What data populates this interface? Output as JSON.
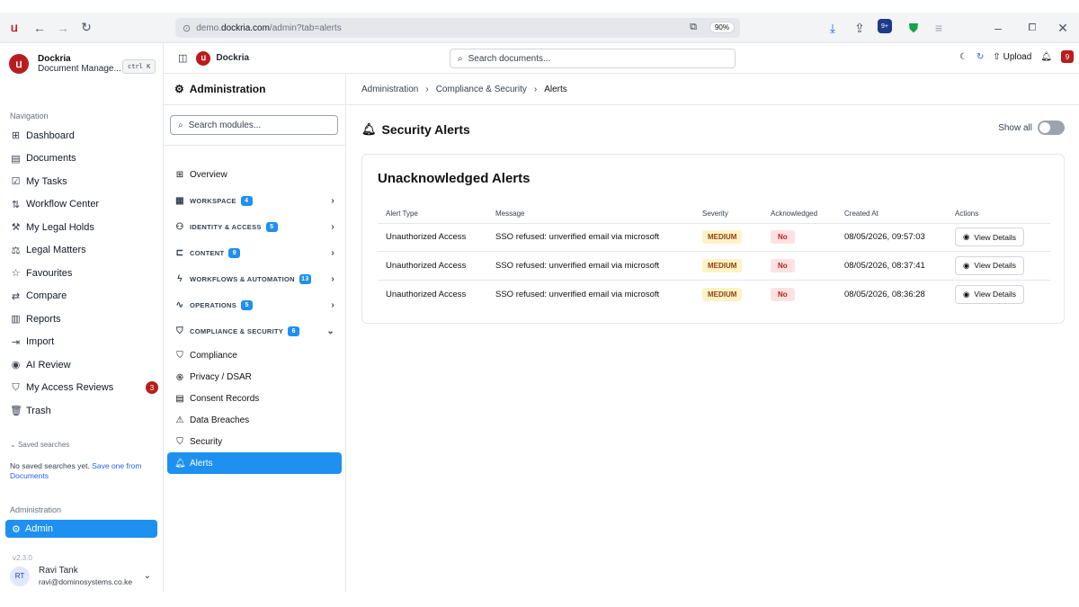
{
  "browser": {
    "url_prefix": "demo.",
    "url_domain": "dockria.com",
    "url_path": "/admin?tab=alerts",
    "zoom": "90%",
    "extension_badge": "9+"
  },
  "app": {
    "name": "Dockria",
    "subtitle": "Document Manage...",
    "shortcut": "ctrl K",
    "version": "v2.3.0"
  },
  "nav": {
    "label": "Navigation",
    "items": [
      {
        "label": "Dashboard",
        "icon": "grid-icon"
      },
      {
        "label": "Documents",
        "icon": "document-icon"
      },
      {
        "label": "My Tasks",
        "icon": "checkbox-icon"
      },
      {
        "label": "Workflow Center",
        "icon": "workflow-icon"
      },
      {
        "label": "My Legal Holds",
        "icon": "gavel-icon"
      },
      {
        "label": "Legal Matters",
        "icon": "scales-icon"
      },
      {
        "label": "Favourites",
        "icon": "star-icon"
      },
      {
        "label": "Compare",
        "icon": "compare-icon"
      },
      {
        "label": "Reports",
        "icon": "chart-icon"
      },
      {
        "label": "Import",
        "icon": "import-icon"
      },
      {
        "label": "AI Review",
        "icon": "ai-icon"
      },
      {
        "label": "My Access Reviews",
        "icon": "shield-check-icon",
        "badge": "3"
      },
      {
        "label": "Trash",
        "icon": "trash-icon"
      }
    ],
    "saved_label": "Saved searches",
    "no_saved": "No saved searches yet.",
    "save_link": "Save one from Documents",
    "admin_label": "Administration",
    "admin_button": "Admin"
  },
  "user": {
    "initials": "RT",
    "name": "Ravi Tank",
    "email": "ravi@dominosystems.co.ke"
  },
  "topbar": {
    "brand": "Dockria",
    "search_placeholder": "Search documents...",
    "upload": "Upload",
    "notifications": "9"
  },
  "admin_nav": {
    "title": "Administration",
    "search_placeholder": "Search modules...",
    "overview": "Overview",
    "sections": [
      {
        "label": "WORKSPACE",
        "count": "4",
        "icon": "building-icon"
      },
      {
        "label": "IDENTITY & ACCESS",
        "count": "5",
        "icon": "users-icon"
      },
      {
        "label": "CONTENT",
        "count": "9",
        "icon": "content-icon"
      },
      {
        "label": "WORKFLOWS & AUTOMATION",
        "count": "13",
        "icon": "lightning-icon"
      },
      {
        "label": "OPERATIONS",
        "count": "5",
        "icon": "pulse-icon"
      },
      {
        "label": "COMPLIANCE & SECURITY",
        "count": "6",
        "icon": "shield-icon"
      }
    ],
    "sub_items": [
      {
        "label": "Compliance",
        "icon": "shield-icon"
      },
      {
        "label": "Privacy / DSAR",
        "icon": "fingerprint-icon"
      },
      {
        "label": "Consent Records",
        "icon": "file-check-icon"
      },
      {
        "label": "Data Breaches",
        "icon": "warning-icon"
      },
      {
        "label": "Security",
        "icon": "shield-icon"
      },
      {
        "label": "Alerts",
        "icon": "bell-icon"
      }
    ]
  },
  "breadcrumb": [
    "Administration",
    "Compliance & Security",
    "Alerts"
  ],
  "page": {
    "title": "Security Alerts",
    "show_all": "Show all",
    "card_title": "Unacknowledged Alerts",
    "columns": [
      "Alert Type",
      "Message",
      "Severity",
      "Acknowledged",
      "Created At",
      "Actions"
    ],
    "rows": [
      {
        "type": "Unauthorized Access",
        "message": "SSO refused: unverified email via microsoft",
        "severity": "MEDIUM",
        "ack": "No",
        "created": "08/05/2026, 09:57:03",
        "action": "View Details"
      },
      {
        "type": "Unauthorized Access",
        "message": "SSO refused: unverified email via microsoft",
        "severity": "MEDIUM",
        "ack": "No",
        "created": "08/05/2026, 08:37:41",
        "action": "View Details"
      },
      {
        "type": "Unauthorized Access",
        "message": "SSO refused: unverified email via microsoft",
        "severity": "MEDIUM",
        "ack": "No",
        "created": "08/05/2026, 08:36:28",
        "action": "View Details"
      }
    ]
  }
}
